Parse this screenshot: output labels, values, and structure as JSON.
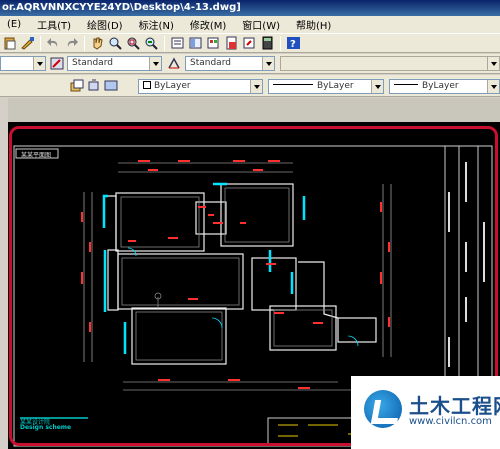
{
  "window": {
    "title": "or.AQRVNNXCYYE24YD\\Desktop\\4-13.dwg]"
  },
  "menu": [
    "(E)",
    "工具(T)",
    "绘图(D)",
    "标注(N)",
    "修改(M)",
    "窗口(W)",
    "帮助(H)"
  ],
  "toolbar2": {
    "textstyle": "Standard",
    "dimstyle": "Standard"
  },
  "toolbar3": {
    "color": "ByLayer",
    "linetype": "ByLayer",
    "lineweight": "ByLayer"
  },
  "drawing": {
    "sheet_title": "某某平面图",
    "brand_line1": "某某设计院",
    "brand_line2": "Design scheme"
  },
  "watermark": {
    "name": "土木工程网",
    "url": "www.civilcn.com"
  },
  "colors": {
    "frame": "#c8102e",
    "wall_highlight": "#00e5ff",
    "dimension": "#ff3030"
  }
}
